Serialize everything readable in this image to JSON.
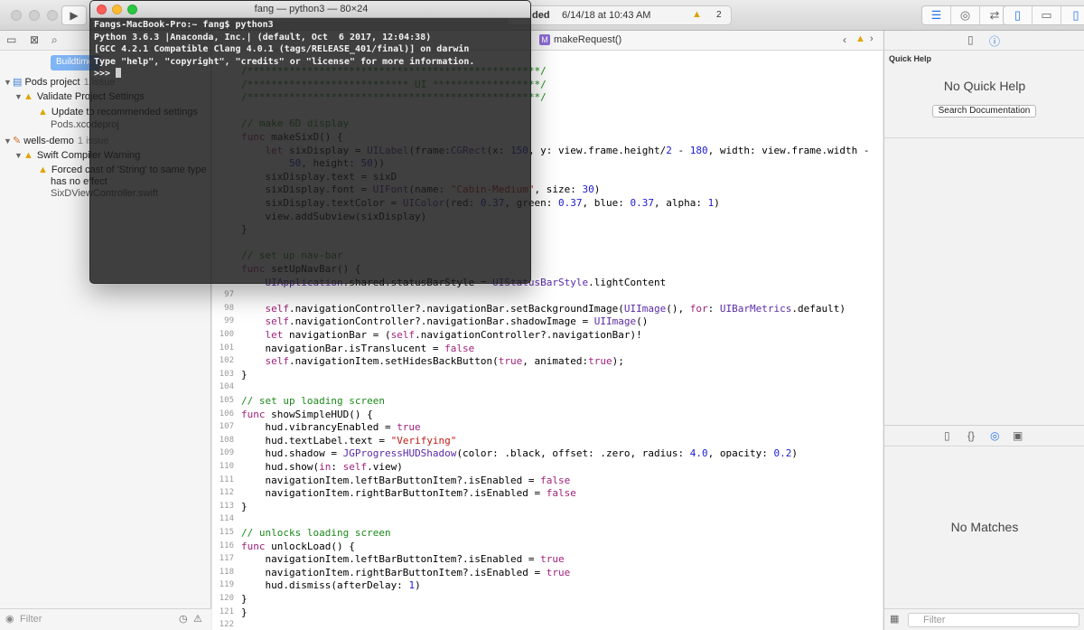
{
  "toolbar": {
    "status_text_bold": "ded",
    "status_text": "6/14/18 at 10:43 AM",
    "warning_count": "2"
  },
  "navigator": {
    "build_pill": "Buildtime",
    "items": [
      {
        "label": "Pods project",
        "count": "1 issue"
      },
      {
        "label": "Validate Project Settings"
      },
      {
        "label": "Update to recommended settings"
      },
      {
        "label": "Pods.xcodeproj"
      },
      {
        "label": "wells-demo",
        "count": "1 issue"
      },
      {
        "label": "Swift Compiler Warning"
      },
      {
        "label": "Forced cast of 'String' to same type"
      },
      {
        "label": "has no effect"
      },
      {
        "label": "SixDViewController.swift"
      }
    ],
    "filter_placeholder": "Filter"
  },
  "editor": {
    "breadcrumb": "makeRequest()",
    "badge": "M",
    "lines": [
      {
        "n": "",
        "t": "/*************************************************/"
      },
      {
        "n": "",
        "t": "/*************************** UI ******************/"
      },
      {
        "n": "",
        "t": "/*************************************************/"
      },
      {
        "n": "",
        "t": ""
      },
      {
        "n": "",
        "t": "// make 6D display"
      },
      {
        "n": "",
        "t": "func makeSixD() {"
      },
      {
        "n": "",
        "t": "    let sixDisplay = UILabel(frame:CGRect(x: 150, y: view.frame.height/2 - 180, width: view.frame.width -"
      },
      {
        "n": "",
        "t": "        50, height: 50))"
      },
      {
        "n": "",
        "t": "    sixDisplay.text = sixD"
      },
      {
        "n": "",
        "t": "    sixDisplay.font = UIFont(name: \"Cabin-Medium\", size: 30)"
      },
      {
        "n": "",
        "t": "    sixDisplay.textColor = UIColor(red: 0.37, green: 0.37, blue: 0.37, alpha: 1)"
      },
      {
        "n": "",
        "t": "    view.addSubview(sixDisplay)"
      },
      {
        "n": "",
        "t": "}"
      },
      {
        "n": "",
        "t": ""
      },
      {
        "n": "",
        "t": "// set up nav-bar"
      },
      {
        "n": "",
        "t": "func setUpNavBar() {"
      },
      {
        "n": "",
        "t": "    UIApplication.shared.statusBarStyle = UIStatusBarStyle.lightContent"
      },
      {
        "n": "97",
        "t": ""
      },
      {
        "n": "98",
        "t": "    self.navigationController?.navigationBar.setBackgroundImage(UIImage(), for: UIBarMetrics.default)"
      },
      {
        "n": "99",
        "t": "    self.navigationController?.navigationBar.shadowImage = UIImage()"
      },
      {
        "n": "100",
        "t": "    let navigationBar = (self.navigationController?.navigationBar)!"
      },
      {
        "n": "101",
        "t": "    navigationBar.isTranslucent = false"
      },
      {
        "n": "102",
        "t": "    self.navigationItem.setHidesBackButton(true, animated:true);"
      },
      {
        "n": "103",
        "t": "}"
      },
      {
        "n": "104",
        "t": ""
      },
      {
        "n": "105",
        "t": "// set up loading screen"
      },
      {
        "n": "106",
        "t": "func showSimpleHUD() {"
      },
      {
        "n": "107",
        "t": "    hud.vibrancyEnabled = true"
      },
      {
        "n": "108",
        "t": "    hud.textLabel.text = \"Verifying\""
      },
      {
        "n": "109",
        "t": "    hud.shadow = JGProgressHUDShadow(color: .black, offset: .zero, radius: 4.0, opacity: 0.2)"
      },
      {
        "n": "110",
        "t": "    hud.show(in: self.view)"
      },
      {
        "n": "111",
        "t": "    navigationItem.leftBarButtonItem?.isEnabled = false"
      },
      {
        "n": "112",
        "t": "    navigationItem.rightBarButtonItem?.isEnabled = false"
      },
      {
        "n": "113",
        "t": "}"
      },
      {
        "n": "114",
        "t": ""
      },
      {
        "n": "115",
        "t": "// unlocks loading screen"
      },
      {
        "n": "116",
        "t": "func unlockLoad() {"
      },
      {
        "n": "117",
        "t": "    navigationItem.leftBarButtonItem?.isEnabled = true"
      },
      {
        "n": "118",
        "t": "    navigationItem.rightBarButtonItem?.isEnabled = true"
      },
      {
        "n": "119",
        "t": "    hud.dismiss(afterDelay: 1)"
      },
      {
        "n": "120",
        "t": "}"
      },
      {
        "n": "121",
        "t": "}"
      },
      {
        "n": "122",
        "t": ""
      }
    ]
  },
  "inspector": {
    "quick_help_title": "Quick Help",
    "no_quick_help": "No Quick Help",
    "search_button": "Search Documentation",
    "no_matches": "No Matches",
    "filter_placeholder": "Filter"
  },
  "terminal": {
    "title": "fang — python3 — 80×24",
    "lines": [
      "Fangs-MacBook-Pro:~ fang$ python3",
      "Python 3.6.3 |Anaconda, Inc.| (default, Oct  6 2017, 12:04:38)",
      "[GCC 4.2.1 Compatible Clang 4.0.1 (tags/RELEASE_401/final)] on darwin",
      "Type \"help\", \"copyright\", \"credits\" or \"license\" for more information."
    ],
    "prompt": ">>> "
  },
  "colors": {
    "comment": "#1b8a1b",
    "keyword": "#a0227b",
    "accent": "#2a78e4",
    "warning": "#e2a500"
  },
  "icons": [
    "play-icon",
    "stop-icon",
    "folder-icon",
    "warning-icon",
    "filter-icon",
    "file-icon",
    "help-icon",
    "braces-icon",
    "target-icon",
    "media-icon",
    "grid-icon",
    "clock-icon"
  ]
}
